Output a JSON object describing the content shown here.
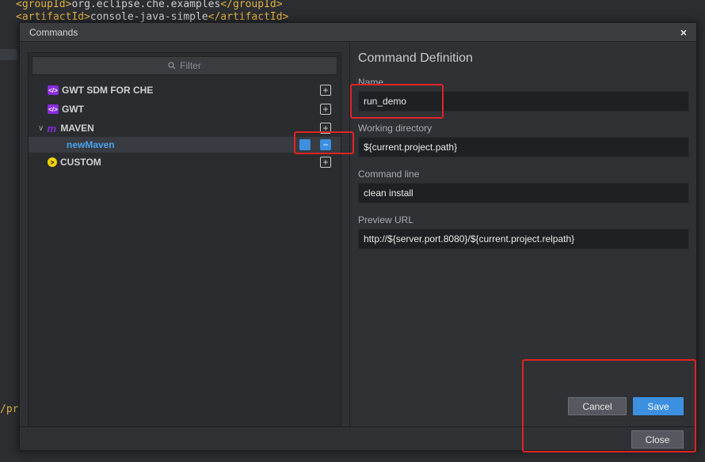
{
  "editor": {
    "line1_open": "<groupId>",
    "line1_value": "org.eclipse.che.examples",
    "line1_close": "</groupId>",
    "line2_open": "<artifactId>",
    "line2_value": "console-java-simple",
    "line2_close": "</artifactId>",
    "side_fragment": "/pr"
  },
  "dialog": {
    "title": "Commands",
    "close_glyph": "×"
  },
  "tree": {
    "filter_placeholder": "Filter",
    "categories": [
      {
        "label": "GWT SDM FOR CHE",
        "icon": "gwt-icon",
        "icon_color": "#8a2be2"
      },
      {
        "label": "GWT",
        "icon": "gwt-icon",
        "icon_color": "#8a2be2"
      },
      {
        "label": "MAVEN",
        "icon": "maven-icon",
        "icon_color": "#8a2be2"
      },
      {
        "label": "CUSTOM",
        "icon": "custom-icon",
        "icon_color": "#f2d200"
      }
    ],
    "selected_command": "newMaven",
    "plus_glyph": "+",
    "minus_glyph": "−"
  },
  "definition": {
    "title": "Command Definition",
    "name_label": "Name",
    "name_value": "run_demo",
    "workdir_label": "Working directory",
    "workdir_value": "${current.project.path}",
    "cmdline_label": "Command line",
    "cmdline_value": "clean install",
    "preview_label": "Preview URL",
    "preview_value": "http://${server.port.8080}/${current.project.relpath}"
  },
  "buttons": {
    "cancel": "Cancel",
    "save": "Save",
    "close": "Close"
  },
  "colors": {
    "accent": "#3d8fe0",
    "highlight": "#e02424"
  }
}
